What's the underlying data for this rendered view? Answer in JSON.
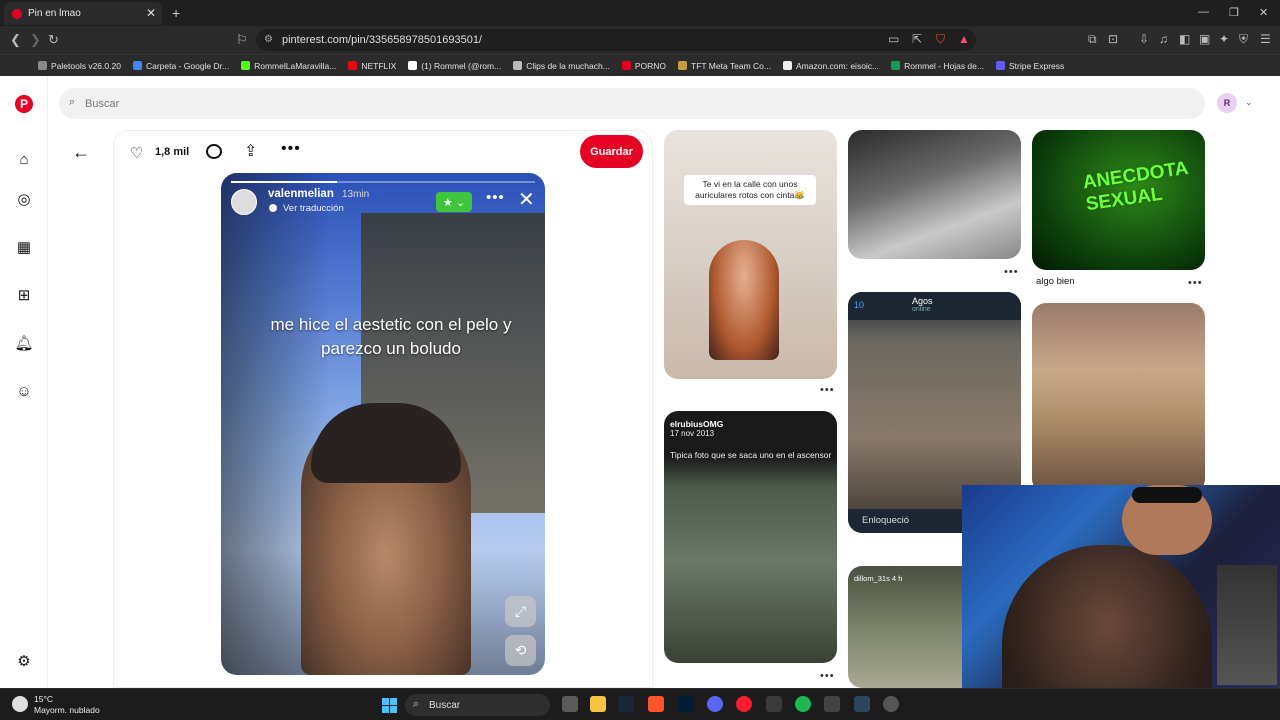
{
  "browser": {
    "tab_title": "Pin en lmao",
    "new_tab": "+",
    "url": "pinterest.com/pin/335658978501693501/",
    "bookmarks": [
      {
        "label": "Paletools v26.0.20",
        "color": "#888888"
      },
      {
        "label": "Carpeta - Google Dr...",
        "color": "#4285f4"
      },
      {
        "label": "RommelLaMaravilla...",
        "color": "#53fc18"
      },
      {
        "label": "NETFLIX",
        "color": "#e50914"
      },
      {
        "label": "(1) Rommel (@rom...",
        "color": "#ffffff"
      },
      {
        "label": "Clips de la muchach...",
        "color": "#bbbbbb"
      },
      {
        "label": "PORNO",
        "color": "#e60023"
      },
      {
        "label": "TFT Meta Team Co...",
        "color": "#c89b3c"
      },
      {
        "label": "Amazon.com: eisoic...",
        "color": "#eeeeee"
      },
      {
        "label": "Rommel - Hojas de...",
        "color": "#0f9d58"
      },
      {
        "label": "Stripe Express",
        "color": "#635bff"
      }
    ]
  },
  "pinterest": {
    "search_placeholder": "Buscar",
    "avatar_letter": "R",
    "pin": {
      "likes": "1,8 mil",
      "save_label": "Guardar",
      "story": {
        "username": "valenmelian",
        "time": "13min",
        "translate": "Ver traducción",
        "caption": "me hice el aestetic con el pelo y parezco un boludo",
        "progress": 0.35
      }
    },
    "grid": {
      "pin1_text": "Te vi en la calle con unos auriculares rotos con cinta😹",
      "pin3_overlay": "ANECDOTA SEXUAL",
      "pin3_label": "algo bien",
      "pin5_user": "elrubiusOMG",
      "pin5_date": "17 nov 2013",
      "pin5_text": "Tipica foto que se saca uno en el ascensor",
      "pin6_back": "10",
      "pin6_name": "Agos",
      "pin6_status": "online",
      "pin6_foot": "Enloqueció",
      "pin7_user": "dillom_31s 4 h"
    }
  },
  "taskbar": {
    "temp": "15°C",
    "weather": "Mayorm. nublado",
    "search": "Buscar"
  },
  "colors": {
    "brand": "#e60023",
    "browser_bg": "#202124"
  }
}
